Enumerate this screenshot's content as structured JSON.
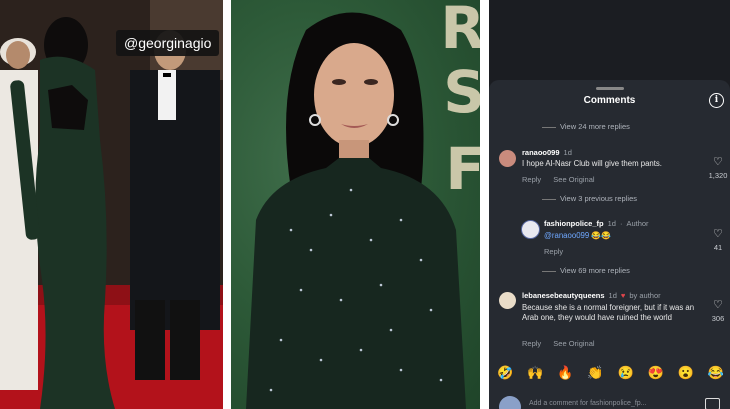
{
  "left_photo": {
    "handle": "@georginagio",
    "description": "Red carpet event, woman in sparkling dark green gown walking away"
  },
  "center_photo": {
    "background_letters": [
      "R",
      "S",
      "F"
    ],
    "description": "Portrait of woman in sheer embellished dark green dress"
  },
  "comments_panel": {
    "title": "Comments",
    "info_icon": "info-icon",
    "threads": [
      {
        "type": "view_more",
        "label": "View 24 more replies"
      },
      {
        "type": "comment",
        "username": "ranaoo099",
        "time": "1d",
        "text": "I hope Al-Nasr Club will give them pants.",
        "actions": [
          "Reply",
          "See Original"
        ],
        "likes": "1,320"
      },
      {
        "type": "view_more",
        "label": "View 3 previous replies"
      },
      {
        "type": "reply",
        "username": "fashionpolice_fp",
        "time": "1d",
        "author_tag": "Author",
        "mention": "@ranaoo099",
        "emoji_text": "😂😂",
        "actions": [
          "Reply"
        ],
        "likes": "41"
      },
      {
        "type": "view_more",
        "label": "View 69 more replies"
      },
      {
        "type": "comment",
        "username": "lebanesebeautyqueens",
        "time": "1d",
        "liked_by": "by author",
        "text": "Because she is a normal foreigner, but if it was an Arab one, they would have ruined the world",
        "actions": [
          "Reply",
          "See Original"
        ],
        "likes": "306"
      }
    ],
    "emoji_bar": [
      "🤣",
      "🙌",
      "🔥",
      "👏",
      "😢",
      "😍",
      "😮",
      "😂"
    ],
    "composer_placeholder": "Add a comment for fashionpolice_fp..."
  },
  "colors": {
    "sheet_bg": "#262a31",
    "mention": "#6fa8ff",
    "muted": "#9aa0a8"
  }
}
